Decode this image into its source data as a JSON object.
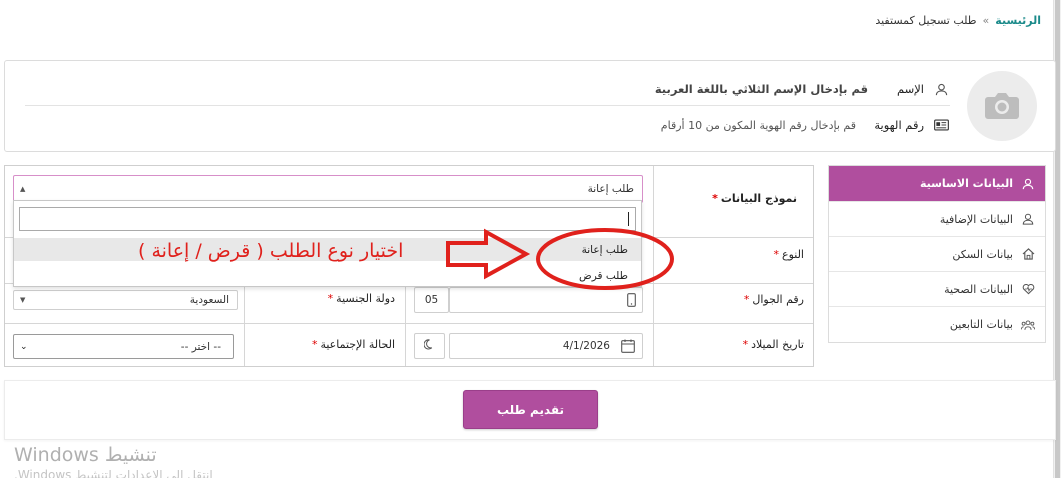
{
  "breadcrumb": {
    "home": "الرئيسية",
    "separator": "»",
    "current": "طلب تسجيل كمستفيد"
  },
  "profile": {
    "name_label": "الإسم",
    "name_hint": "قم بإدخال الإسم الثلاثي باللغة العربية",
    "id_label": "رقم الهوية",
    "id_hint": "قم بإدخال رقم الهوية المكون من 10 أرقام",
    "avatar_icon": "camera-icon"
  },
  "side_tabs": [
    {
      "label": "البيانات الاساسية",
      "icon": "user-icon",
      "active": true
    },
    {
      "label": "البيانات الإضافية",
      "icon": "user-outline-icon",
      "active": false
    },
    {
      "label": "بيانات السكن",
      "icon": "home-icon",
      "active": false
    },
    {
      "label": "البيانات الصحية",
      "icon": "heart-pulse-icon",
      "active": false
    },
    {
      "label": "بيانات التابعين",
      "icon": "users-icon",
      "active": false
    }
  ],
  "form": {
    "data_model_label": "نموذج البيانات",
    "data_model_value": "طلب إعانة",
    "gender_label": "النوع",
    "mobile_label": "رقم الجوال",
    "mobile_prefix": "05",
    "nationality_label": "دولة الجنسية",
    "nationality_value": "السعودية",
    "birth_date_label": "تاريخ الميلاد",
    "birth_date_value": "4/1/2026",
    "marital_label": "الحالة الإجتماعية",
    "marital_value": "-- اختر --",
    "required_mark": "*"
  },
  "dropdown": {
    "search_value": "",
    "options": [
      "طلب إعانة",
      "طلب قرض"
    ],
    "highlighted_index": 0
  },
  "annotation": {
    "text": "اختيار نوع الطلب ( قرض / إعانة )",
    "color": "#e0211c"
  },
  "submit": {
    "label": "تقديم طلب"
  },
  "watermark": {
    "line1": "تنشيط Windows",
    "line2": "انتقل إلى الإعدادات لتنشيط Windows."
  },
  "colors": {
    "accent": "#b04e9e",
    "link": "#1b8a8a"
  }
}
